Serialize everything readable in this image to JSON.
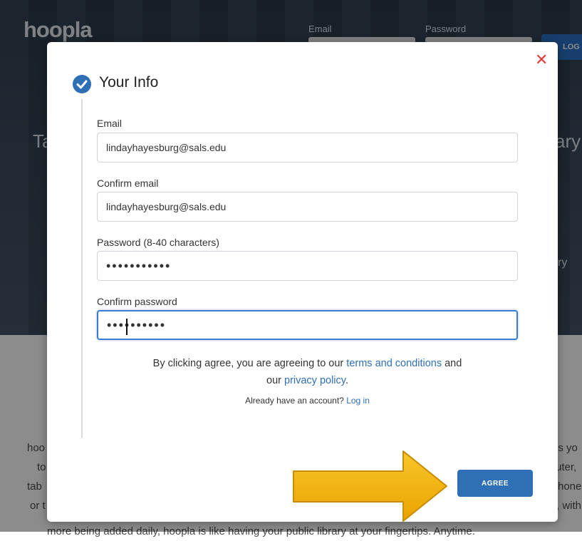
{
  "background": {
    "logo": "hoopla",
    "header": {
      "email_label": "Email",
      "password_label": "Password",
      "login_label": "LOG"
    },
    "hero_left": "Ta",
    "hero_right": "ary",
    "hero_right2": "ry",
    "para_left": [
      "hoo",
      "to",
      "tab",
      "or t"
    ],
    "para_right": [
      "us yo",
      "uter,",
      "hone",
      ", with"
    ],
    "para_bottom": "more being added daily, hoopla is like having your public library at your fingertips. Anytime."
  },
  "modal": {
    "close_symbol": "✕",
    "step_title": "Your Info",
    "fields": [
      {
        "label": "Email",
        "value": "lindayhayesburg@sals.edu"
      },
      {
        "label": "Confirm email",
        "value": "lindayhayesburg@sals.edu"
      },
      {
        "label": "Password (8-40 characters)",
        "value": "•••••••••••"
      },
      {
        "label": "Confirm password",
        "value": "••••••••••"
      }
    ],
    "consent": {
      "prefix": "By clicking agree, you are agreeing to our ",
      "terms_link": "terms and conditions",
      "middle": " and",
      "line2_prefix": "our ",
      "privacy_link": "privacy policy",
      "suffix": "."
    },
    "already": {
      "text": "Already have an account? ",
      "login_link": "Log in"
    },
    "agree_label": "AGREE"
  },
  "colors": {
    "accent": "#2f6fb6",
    "close": "#e5383b",
    "arrow": "#f4b400"
  },
  "icons": [
    "check-circle-icon",
    "close-icon",
    "arrow-right-icon"
  ]
}
